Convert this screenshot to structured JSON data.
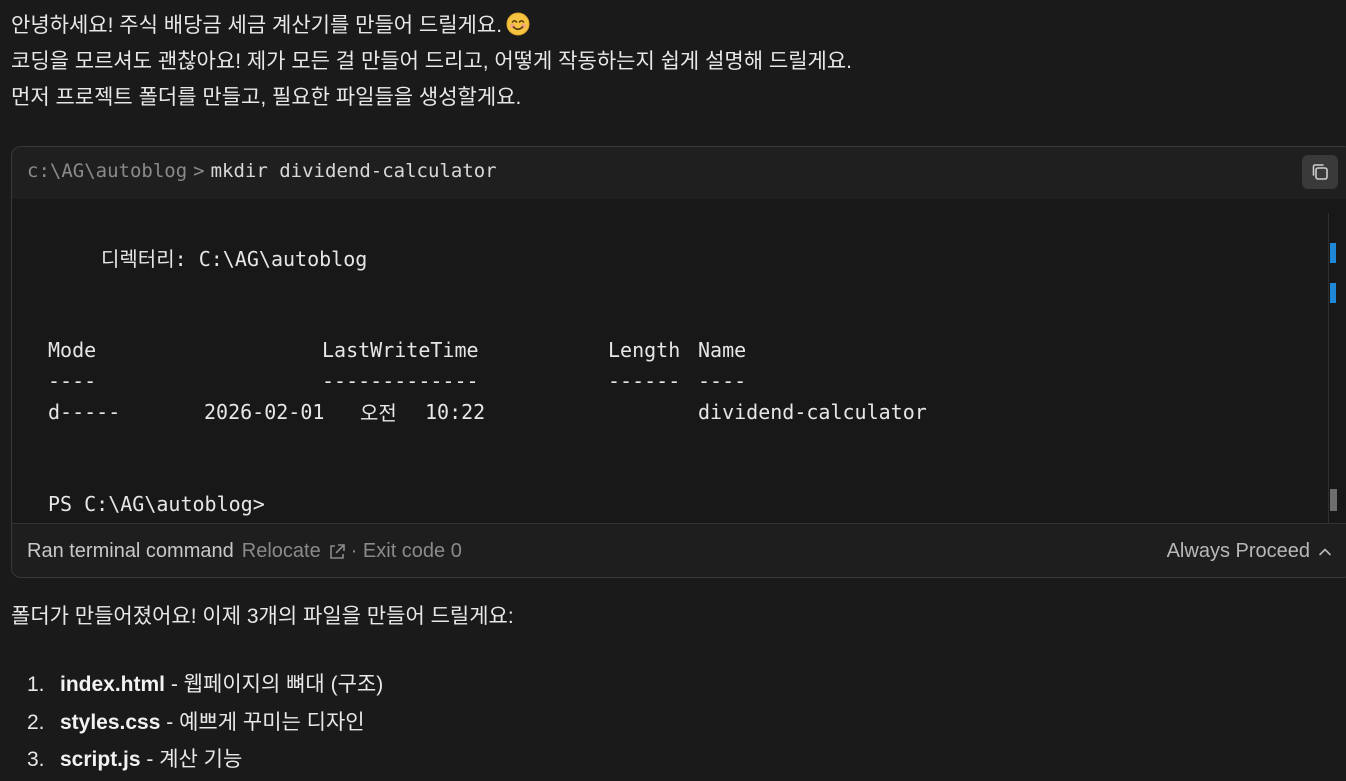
{
  "intro": {
    "line1": "안녕하세요! 주식 배당금 세금 계산기를 만들어 드릴게요.",
    "emoji_icon": "smiling-face-emoji",
    "line2": "코딩을 모르셔도 괜찮아요! 제가 모든 걸 만들어 드리고, 어떻게 작동하는지 쉽게 설명해 드릴게요.",
    "line3": "먼저 프로젝트 폴더를 만들고, 필요한 파일들을 생성할게요."
  },
  "terminal": {
    "cwd": "c:\\AG\\autoblog",
    "separator": ">",
    "command": "mkdir dividend-calculator",
    "output": {
      "directory_label": "디렉터리:",
      "directory_path": "C:\\AG\\autoblog",
      "headers": [
        "Mode",
        "LastWriteTime",
        "Length",
        "Name"
      ],
      "underlines": [
        "----",
        "-------------",
        "------",
        "----"
      ],
      "row": {
        "mode": "d-----",
        "date": "2026-02-01",
        "ampm": "오전",
        "time": "10:22",
        "length": "",
        "name": "dividend-calculator"
      },
      "prompt": "PS C:\\AG\\autoblog>"
    },
    "footer": {
      "ran_label": "Ran terminal command",
      "relocate": "Relocate",
      "exit_code": "· Exit code 0",
      "always_proceed": "Always Proceed"
    }
  },
  "after_text": "폴더가 만들어졌어요! 이제 3개의 파일을 만들어 드릴게요:",
  "files": [
    {
      "num": "1.",
      "file": "index.html",
      "desc": " - 웹페이지의 뼈대 (구조)"
    },
    {
      "num": "2.",
      "file": "styles.css",
      "desc": " - 예쁘게 꾸미는 디자인"
    },
    {
      "num": "3.",
      "file": "script.js",
      "desc": " - 계산 기능"
    }
  ],
  "colors": {
    "background": "#1a1a1a",
    "terminal_bg": "#181818",
    "scroll_marker": "#1e88d6"
  }
}
